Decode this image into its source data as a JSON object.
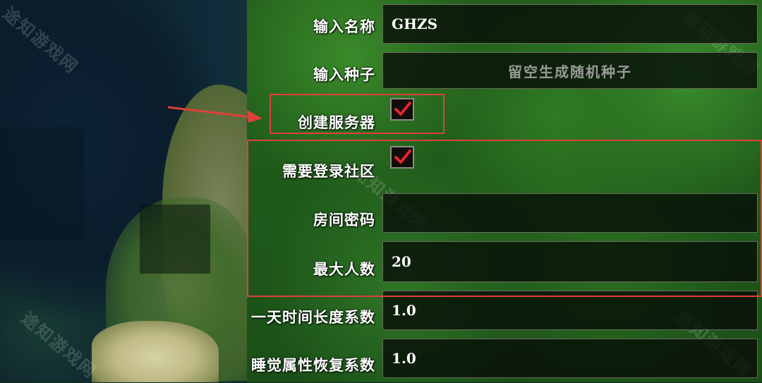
{
  "form": {
    "name": {
      "label": "输入名称",
      "value": "GHZS"
    },
    "seed": {
      "label": "输入种子",
      "placeholder": "留空生成随机种子"
    },
    "create_server": {
      "label": "创建服务器",
      "checked": true
    },
    "require_login": {
      "label": "需要登录社区",
      "checked": true
    },
    "room_password": {
      "label": "房间密码",
      "value": ""
    },
    "max_players": {
      "label": "最大人数",
      "value": "20"
    },
    "day_length": {
      "label": "一天时间长度系数",
      "value": "1.0"
    },
    "sleep_recovery": {
      "label": "睡觉属性恢复系数",
      "value": "1.0"
    }
  },
  "watermark": "途知游戏网",
  "colors": {
    "highlight": "#e0403a",
    "check": "#e8242c"
  }
}
